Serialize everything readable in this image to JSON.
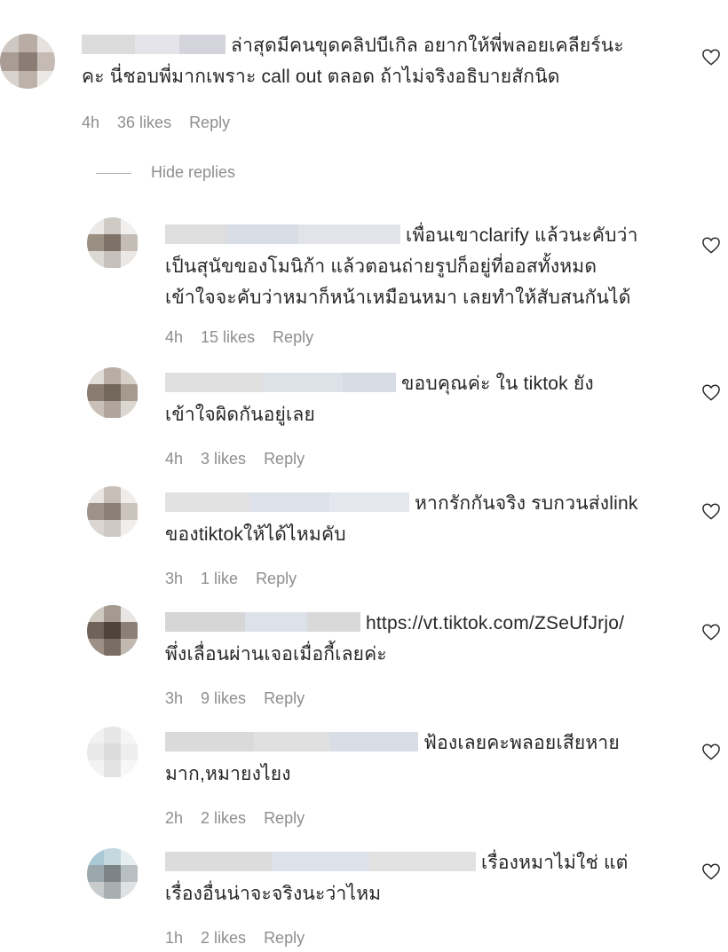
{
  "comments": [
    {
      "text_lines": [
        "ล่าสุดมีคนขุดคลิปบีเกิล อยากให้พี่พลอยเคลียร์นะ",
        "คะ นี่ชอบพี่มากเพราะ call out ตลอด ถ้าไม่จริงอธิบายสักนิด"
      ],
      "time": "4h",
      "likes": "36 likes",
      "reply": "Reply"
    },
    {
      "text_lines": [
        "เพื่อนเขาclarify แล้วนะคับว่า",
        "เป็นสุนัขของโมนิก้า แล้วตอนถ่ายรูปก็อยู่ที่ออสทั้งหมด",
        "เข้าใจจะคับว่าหมาก็หน้าเหมือนหมา เลยทำให้สับสนกันได้"
      ],
      "time": "4h",
      "likes": "15 likes",
      "reply": "Reply"
    },
    {
      "text_lines": [
        "ขอบคุณค่ะ ใน tiktok ยัง",
        "เข้าใจผิดกันอยู่เลย"
      ],
      "time": "4h",
      "likes": "3 likes",
      "reply": "Reply"
    },
    {
      "text_lines": [
        "หากรักกันจริง รบกวนส่งlink",
        "ของtiktokให้ได้ไหมคับ"
      ],
      "time": "3h",
      "likes": "1 like",
      "reply": "Reply"
    },
    {
      "text_lines": [
        "https://vt.tiktok.com/ZSeUfJrjo/",
        "พึ่งเลื่อนผ่านเจอเมื่อกี้เลยค่ะ"
      ],
      "time": "3h",
      "likes": "9 likes",
      "reply": "Reply"
    },
    {
      "text_lines": [
        "ฟ้องเลยคะพลอยเสียหาย",
        "มาก,หมายงไยง"
      ],
      "time": "2h",
      "likes": "2 likes",
      "reply": "Reply"
    },
    {
      "text_lines": [
        "เรื่องหมาไม่ใช่ แต่",
        "เรื่องอื่นน่าจะจริงนะว่าไหม"
      ],
      "time": "1h",
      "likes": "2 likes",
      "reply": "Reply"
    }
  ],
  "hide_replies": "Hide replies",
  "icons": {
    "like": "heart-outline-icon",
    "avatar": "pixelated-avatar"
  },
  "colors": {
    "text": "#262626",
    "meta": "#8e8e8e",
    "heart": "#262626"
  }
}
